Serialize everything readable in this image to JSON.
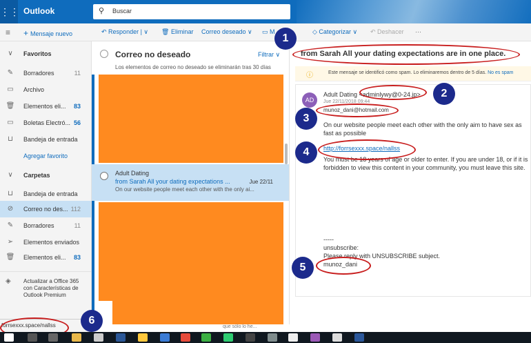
{
  "header": {
    "app_name": "Outlook",
    "search_placeholder": "Buscar"
  },
  "toolbar": {
    "new_mail": "Mensaje nuevo",
    "reply": "Responder",
    "delete": "Eliminar",
    "junk": "Correo deseado",
    "move": "M",
    "categorize": "Categorizar",
    "undo": "Deshacer",
    "more": "···"
  },
  "nav": {
    "favorites": "Favoritos",
    "items_fav": [
      {
        "label": "Borradores",
        "count": "11",
        "bold": false
      },
      {
        "label": "Archivo",
        "count": "",
        "bold": false
      },
      {
        "label": "Elementos eli...",
        "count": "83",
        "bold": true
      },
      {
        "label": "Boletas Electró...",
        "count": "56",
        "bold": true
      },
      {
        "label": "Bandeja de entrada",
        "count": "",
        "bold": false
      }
    ],
    "add_favorite": "Agregar favorito",
    "folders": "Carpetas",
    "items_folders": [
      {
        "label": "Bandeja de entrada",
        "count": ""
      },
      {
        "label": "Correo no des...",
        "count": "112"
      },
      {
        "label": "Borradores",
        "count": "11"
      },
      {
        "label": "Elementos enviados",
        "count": ""
      },
      {
        "label": "Elementos eli...",
        "count": "83"
      }
    ],
    "promo": "Actualizar a Office 365 con Características de Outlook Premium"
  },
  "list": {
    "title": "Correo no deseado",
    "filter": "Filtrar",
    "note": "Los elementos de correo no deseado se eliminarán tras 30 días",
    "message": {
      "from": "Adult Dating",
      "subject": "from Sarah All your dating expectations ...",
      "date": "Jue 22/11",
      "preview": "On our website people meet each other with the only ai..."
    }
  },
  "reading": {
    "subject": "from Sarah All your dating expectations are in one place.",
    "spam_notice": "Este mensaje se identificó como spam. Lo eliminaremos dentro de 5 días.",
    "not_spam": "No es spam",
    "avatar": "AD",
    "sender_name": "Adult Dating",
    "sender_email": "<adminlywy@0-24.jp>",
    "date": "Jue 22/11/2018 09:44",
    "to": "munoz_dani@hotmail.com",
    "body1": "On our website people meet each other with the only aim to have sex as fast as possible",
    "link": "http://forrsexxx.space/nallss",
    "body2": "You must be 18 years of age or older to enter. If you are under 18, or if it is forbidden to view this content in your community, you must leave this site.",
    "dashes": "-----",
    "unsubscribe": "unsubscribe:",
    "reply_note": "Please reply with UNSUBSCRIBE subject.",
    "signature": "munoz_dani"
  },
  "status_url": "forrsexxx.space/nallss",
  "footer_text": "que sólo lo he...",
  "annotations": [
    "1",
    "2",
    "3",
    "4",
    "5",
    "6"
  ],
  "colors": {
    "brand": "#0f6cbd",
    "annotation_red": "#c81e1e",
    "badge_blue": "#1c2a8c",
    "redaction": "#ff8a1f"
  }
}
